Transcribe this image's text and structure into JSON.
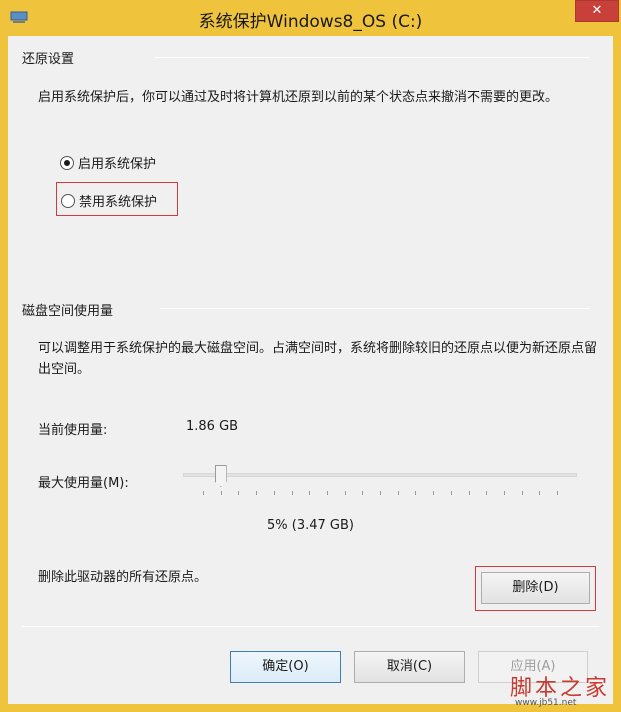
{
  "window": {
    "title": "系统保护Windows8_OS (C:)",
    "close_glyph": "✕"
  },
  "restore_settings": {
    "group_title": "还原设置",
    "description": "启用系统保护后，你可以通过及时将计算机还原到以前的某个状态点来撤消不需要的更改。",
    "options": [
      {
        "label": "启用系统保护",
        "checked": true
      },
      {
        "label": "禁用系统保护",
        "checked": false
      }
    ]
  },
  "disk_usage": {
    "group_title": "磁盘空间使用量",
    "description": "可以调整用于系统保护的最大磁盘空间。占满空间时，系统将删除较旧的还原点以便为新还原点留出空间。",
    "current_label": "当前使用量:",
    "current_value": "1.86 GB",
    "max_label": "最大使用量(M):",
    "max_percent": 5,
    "max_readout": "5% (3.47 GB)",
    "delete_text": "删除此驱动器的所有还原点。",
    "delete_button": "删除(D)"
  },
  "footer": {
    "ok_button": "确定(O)",
    "cancel_button": "取消(C)",
    "apply_button": "应用(A)"
  },
  "watermark": {
    "text": "脚本之家",
    "url": "www.jb51.net"
  },
  "colors": {
    "titlebar": "#f0c33c",
    "close": "#c7403a",
    "highlight": "#d23b3b"
  }
}
